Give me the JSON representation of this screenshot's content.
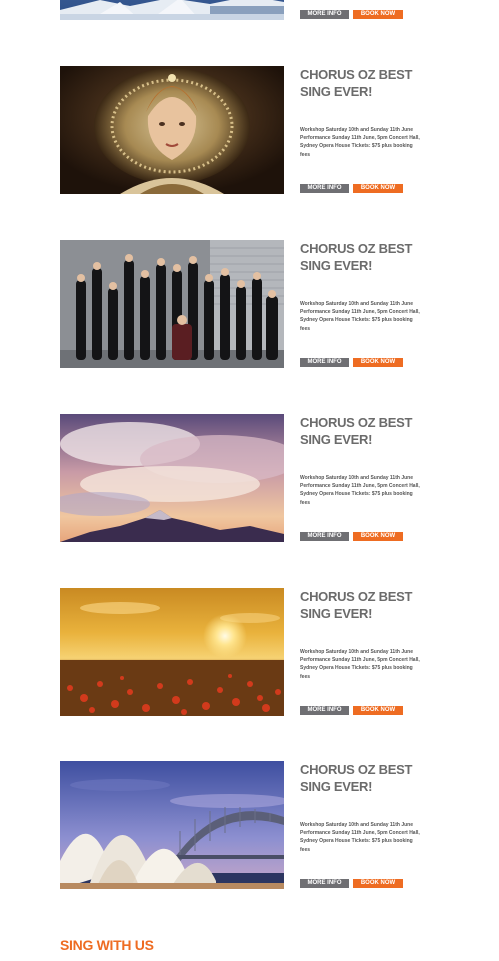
{
  "top_event": {
    "more_info_label": "MORE INFO",
    "book_now_label": "BOOK NOW"
  },
  "events": [
    {
      "title": "CHORUS OZ BEST SING EVER!",
      "description": "Workshop Saturday 10th and Sunday 11th June Performance Sunday 11th June, 5pm Concert Hall, Sydney Opera House Tickets: $75 plus booking fees",
      "more_info_label": "MORE INFO",
      "book_now_label": "BOOK NOW"
    },
    {
      "title": "CHORUS OZ BEST SING EVER!",
      "description": "Workshop Saturday 10th and Sunday 11th June Performance Sunday 11th June, 5pm Concert Hall, Sydney Opera House Tickets: $75 plus booking fees",
      "more_info_label": "MORE INFO",
      "book_now_label": "BOOK NOW"
    },
    {
      "title": "CHORUS OZ BEST SING EVER!",
      "description": "Workshop Saturday 10th and Sunday 11th June Performance Sunday 11th June, 5pm Concert Hall, Sydney Opera House Tickets: $75 plus booking fees",
      "more_info_label": "MORE INFO",
      "book_now_label": "BOOK NOW"
    },
    {
      "title": "CHORUS OZ BEST SING EVER!",
      "description": "Workshop Saturday 10th and Sunday 11th June Performance Sunday 11th June, 5pm Concert Hall, Sydney Opera House Tickets: $75 plus booking fees",
      "more_info_label": "MORE INFO",
      "book_now_label": "BOOK NOW"
    },
    {
      "title": "CHORUS OZ BEST SING EVER!",
      "description": "Workshop Saturday 10th and Sunday 11th June Performance Sunday 11th June, 5pm Concert Hall, Sydney Opera House Tickets: $75 plus booking fees",
      "more_info_label": "MORE INFO",
      "book_now_label": "BOOK NOW"
    }
  ],
  "section": {
    "heading": "SING WITH US"
  },
  "colors": {
    "more_info_button": "#6f6f73",
    "book_now_button": "#ee6c22",
    "title_text": "#6b6b6b",
    "section_heading": "#ee6c22"
  },
  "images": [
    "opera-house-icon",
    "elizabethan-portrait-icon",
    "choir-group-photo-icon",
    "mountain-sunset-clouds-icon",
    "poppy-field-sunset-icon",
    "sydney-opera-house-harbour-bridge-icon"
  ]
}
